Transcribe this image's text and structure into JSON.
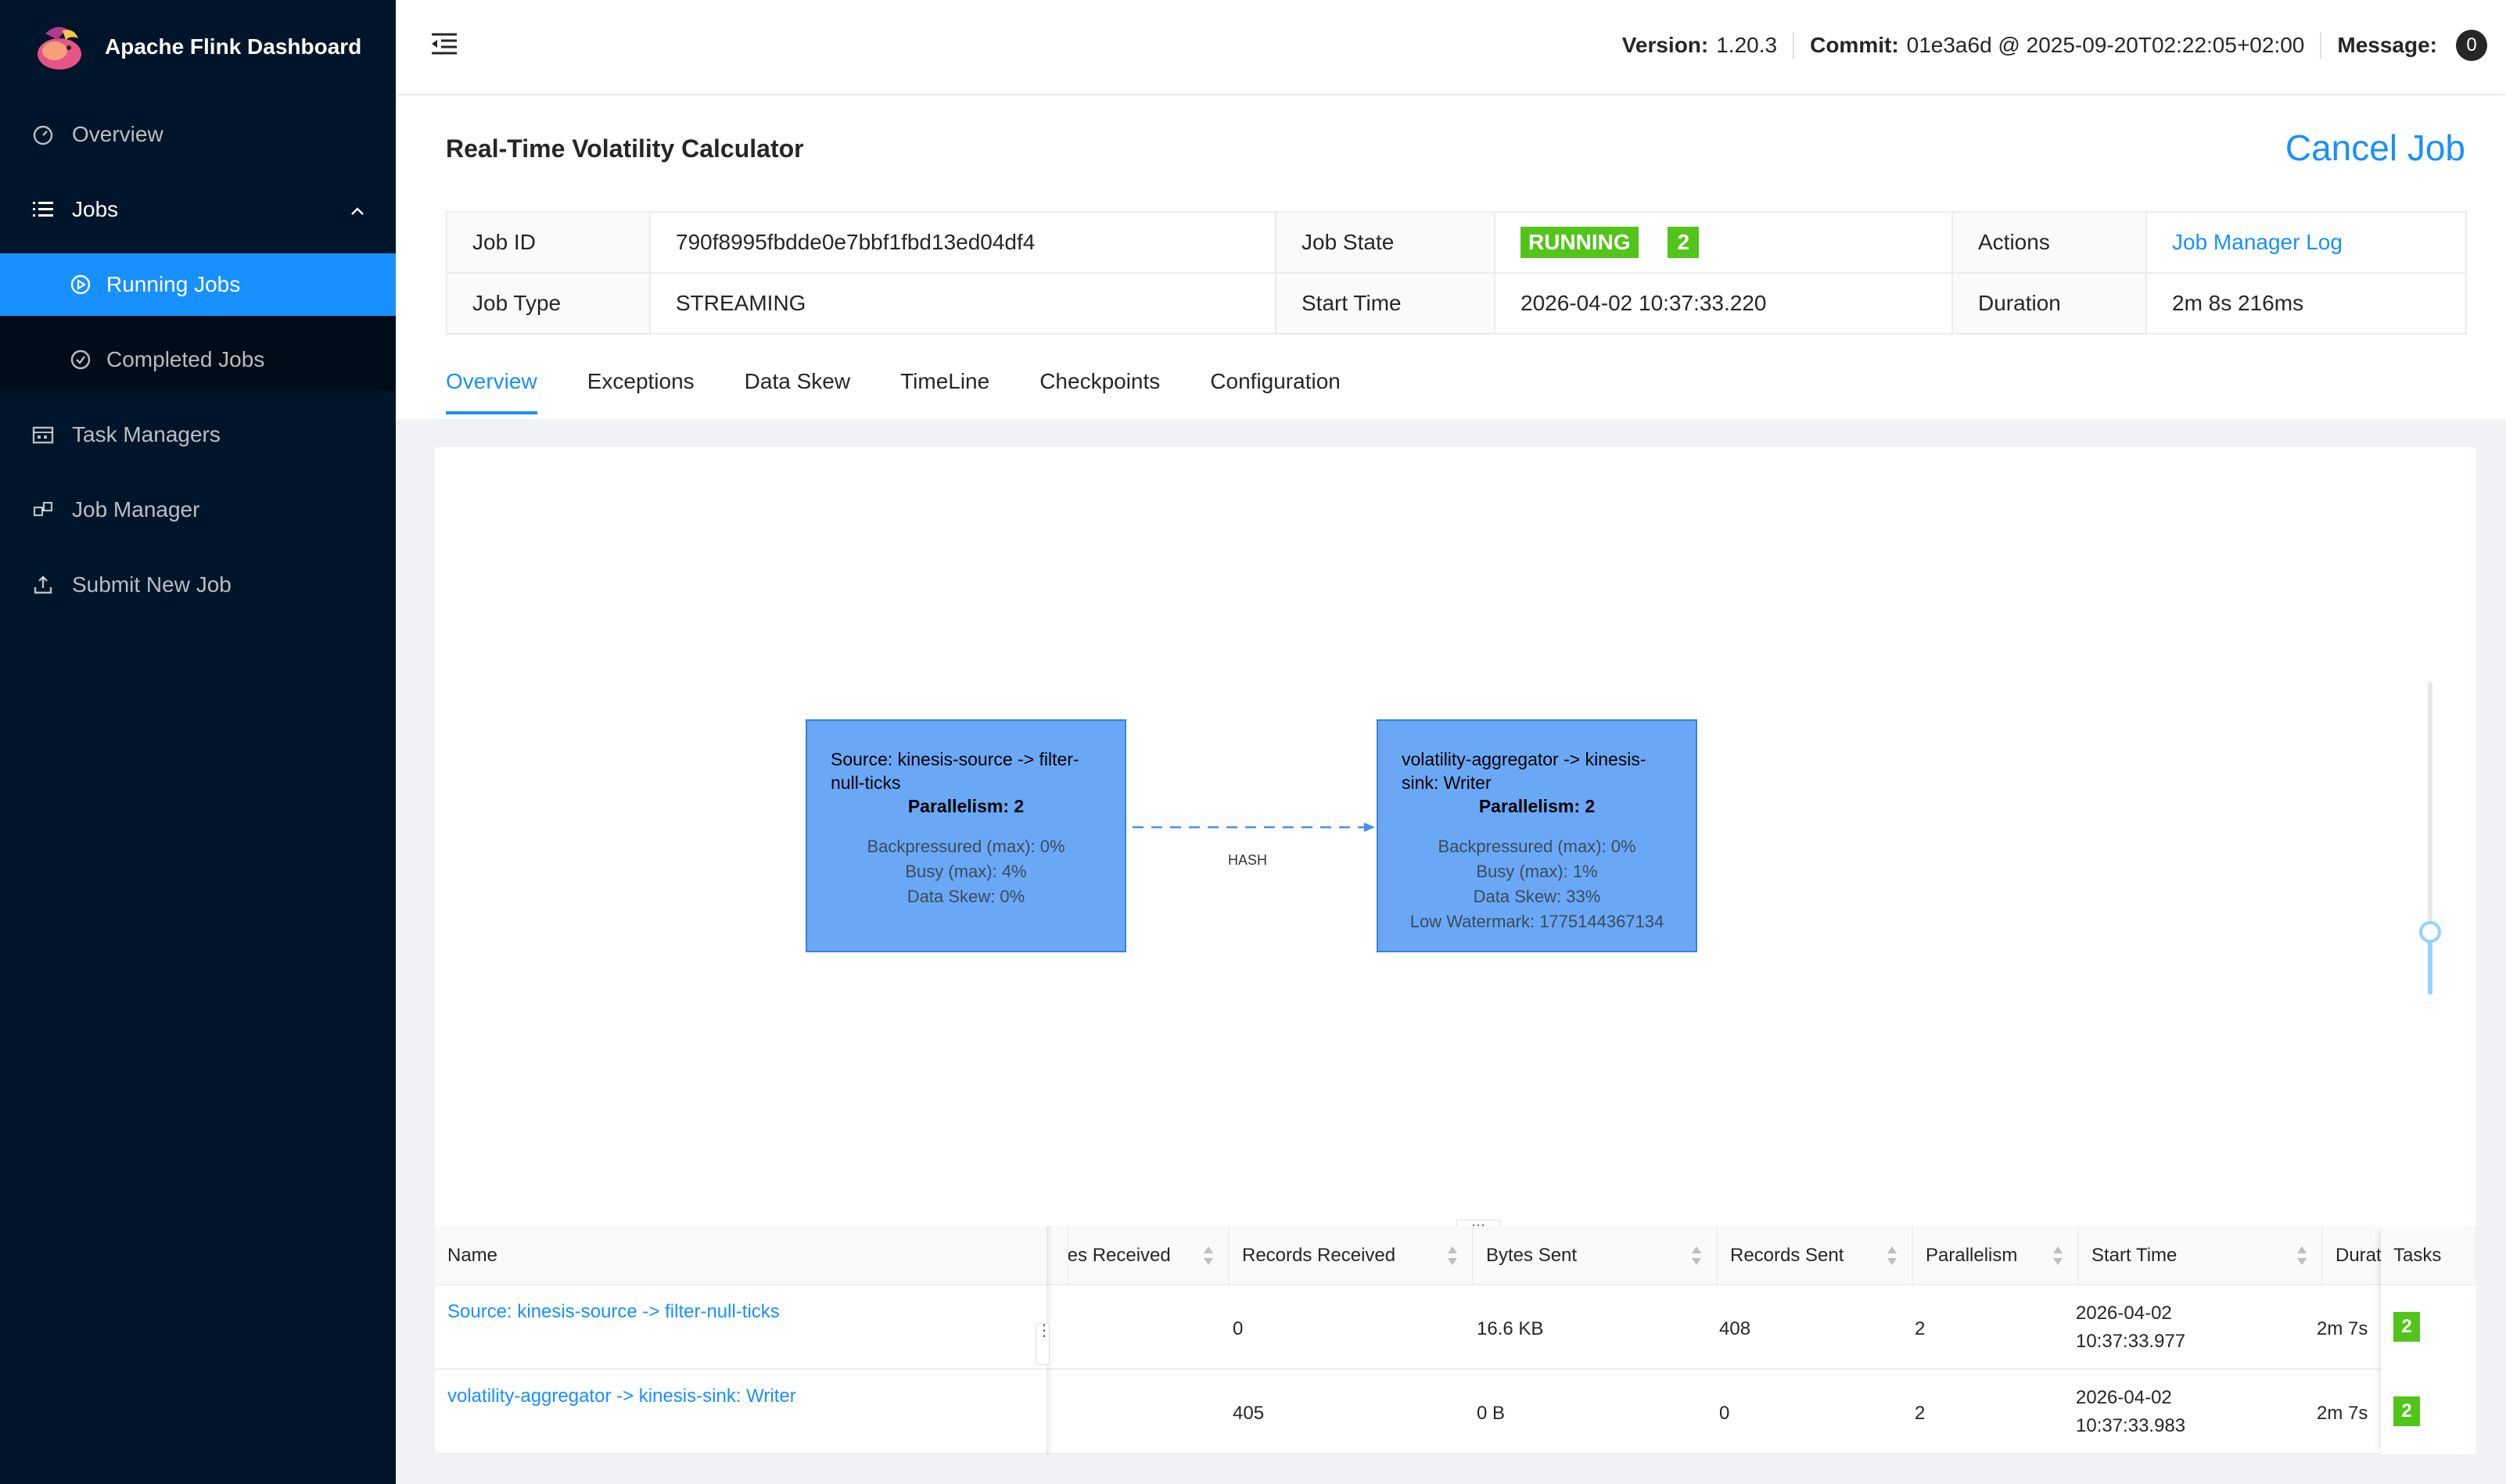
{
  "brand": {
    "title": "Apache Flink Dashboard"
  },
  "nav": {
    "overview": "Overview",
    "jobs": "Jobs",
    "running_jobs": "Running Jobs",
    "completed_jobs": "Completed Jobs",
    "task_managers": "Task Managers",
    "job_manager": "Job Manager",
    "submit_new_job": "Submit New Job"
  },
  "header": {
    "version_label": "Version:",
    "version": "1.20.3",
    "commit_label": "Commit:",
    "commit": "01e3a6d @ 2025-09-20T02:22:05+02:00",
    "message_label": "Message:",
    "message_count": "0"
  },
  "job": {
    "title": "Real-Time Volatility Calculator",
    "cancel": "Cancel Job",
    "id_label": "Job ID",
    "id": "790f8995fbdde0e7bbf1fbd13ed04df4",
    "state_label": "Job State",
    "state": "RUNNING",
    "state_count": "2",
    "actions_label": "Actions",
    "actions_link": "Job Manager Log",
    "type_label": "Job Type",
    "type": "STREAMING",
    "start_label": "Start Time",
    "start": "2026-04-02 10:37:33.220",
    "duration_label": "Duration",
    "duration": "2m 8s 216ms"
  },
  "tabs": [
    "Overview",
    "Exceptions",
    "Data Skew",
    "TimeLine",
    "Checkpoints",
    "Configuration"
  ],
  "graph": {
    "nodes": [
      {
        "title": "Source: kinesis-source -> filter-null-ticks",
        "parallelism": "Parallelism: 2",
        "metrics": [
          "Backpressured (max): 0%",
          "Busy (max): 4%",
          "Data Skew: 0%"
        ]
      },
      {
        "title": "volatility-aggregator -> kinesis-sink: Writer",
        "parallelism": "Parallelism: 2",
        "metrics": [
          "Backpressured (max): 0%",
          "Busy (max): 1%",
          "Data Skew: 33%",
          "Low Watermark: 1775144367134"
        ]
      }
    ],
    "edge_label": "HASH"
  },
  "table": {
    "headers": {
      "name": "Name",
      "bytes_received": "Bytes Received",
      "records_received": "Records Received",
      "bytes_sent": "Bytes Sent",
      "records_sent": "Records Sent",
      "parallelism": "Parallelism",
      "start_time": "Start Time",
      "duration": "Duration",
      "tasks": "Tasks"
    },
    "rows": [
      {
        "name": "Source: kinesis-source -> filter-null-ticks",
        "records_received": "0",
        "bytes_sent": "16.6 KB",
        "records_sent": "408",
        "parallelism": "2",
        "start_date": "2026-04-02",
        "start_time": "10:37:33.977",
        "duration": "2m 7s",
        "tasks": "2"
      },
      {
        "name": "volatility-aggregator -> kinesis-sink: Writer",
        "records_received": "405",
        "bytes_sent": "0 B",
        "records_sent": "0",
        "parallelism": "2",
        "start_date": "2026-04-02",
        "start_time": "10:37:33.983",
        "duration": "2m 7s",
        "tasks": "2"
      }
    ]
  },
  "colors": {
    "accent": "#1890ff",
    "sidebar": "#001529",
    "running": "#52c41a",
    "node": "#6aa8f5"
  }
}
